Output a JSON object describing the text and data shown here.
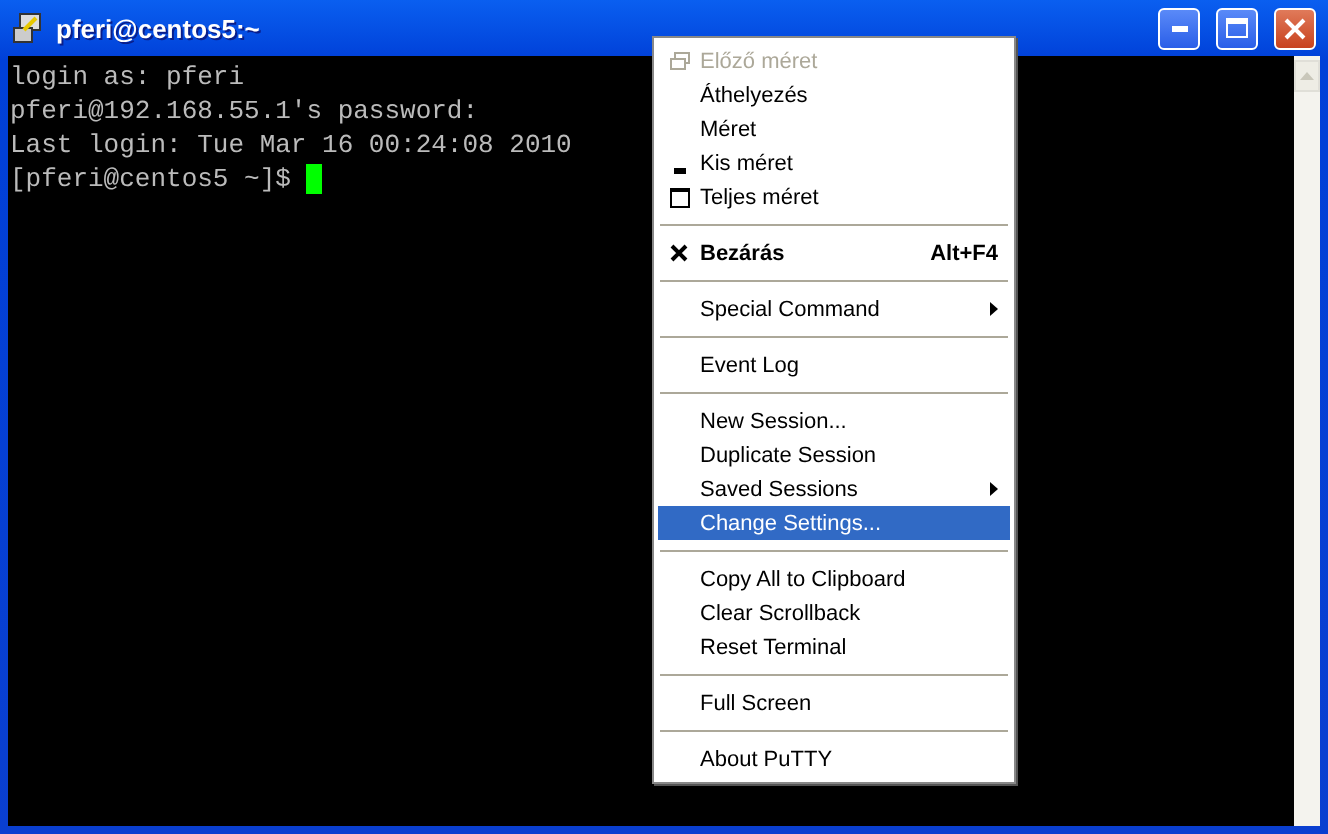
{
  "window": {
    "title": "pferi@centos5:~"
  },
  "terminal": {
    "lines": [
      "login as: pferi",
      "pferi@192.168.55.1's password:",
      "Last login: Tue Mar 16 00:24:08 2010"
    ],
    "prompt": "[pferi@centos5 ~]$ "
  },
  "menu": [
    {
      "kind": "restore",
      "label": "Előző méret",
      "disabled": true,
      "selected": false
    },
    {
      "kind": "plain",
      "label": "Áthelyezés",
      "disabled": false,
      "selected": false
    },
    {
      "kind": "plain",
      "label": "Méret",
      "disabled": false,
      "selected": false
    },
    {
      "kind": "minimize",
      "label": "Kis méret",
      "disabled": false,
      "selected": false
    },
    {
      "kind": "maximize",
      "label": "Teljes méret",
      "disabled": false,
      "selected": false
    },
    {
      "kind": "separator"
    },
    {
      "kind": "close",
      "label": "Bezárás",
      "shortcut": "Alt+F4",
      "disabled": false,
      "selected": false
    },
    {
      "kind": "separator"
    },
    {
      "kind": "submenu",
      "label": "Special Command",
      "disabled": false,
      "selected": false
    },
    {
      "kind": "separator"
    },
    {
      "kind": "plain",
      "label": "Event Log",
      "disabled": false,
      "selected": false
    },
    {
      "kind": "separator"
    },
    {
      "kind": "plain",
      "label": "New Session...",
      "disabled": false,
      "selected": false
    },
    {
      "kind": "plain",
      "label": "Duplicate Session",
      "disabled": false,
      "selected": false
    },
    {
      "kind": "submenu",
      "label": "Saved Sessions",
      "disabled": false,
      "selected": false
    },
    {
      "kind": "plain",
      "label": "Change Settings...",
      "disabled": false,
      "selected": true
    },
    {
      "kind": "separator"
    },
    {
      "kind": "plain",
      "label": "Copy All to Clipboard",
      "disabled": false,
      "selected": false
    },
    {
      "kind": "plain",
      "label": "Clear Scrollback",
      "disabled": false,
      "selected": false
    },
    {
      "kind": "plain",
      "label": "Reset Terminal",
      "disabled": false,
      "selected": false
    },
    {
      "kind": "separator"
    },
    {
      "kind": "plain",
      "label": "Full Screen",
      "disabled": false,
      "selected": false
    },
    {
      "kind": "separator"
    },
    {
      "kind": "plain",
      "label": "About PuTTY",
      "disabled": false,
      "selected": false
    }
  ]
}
